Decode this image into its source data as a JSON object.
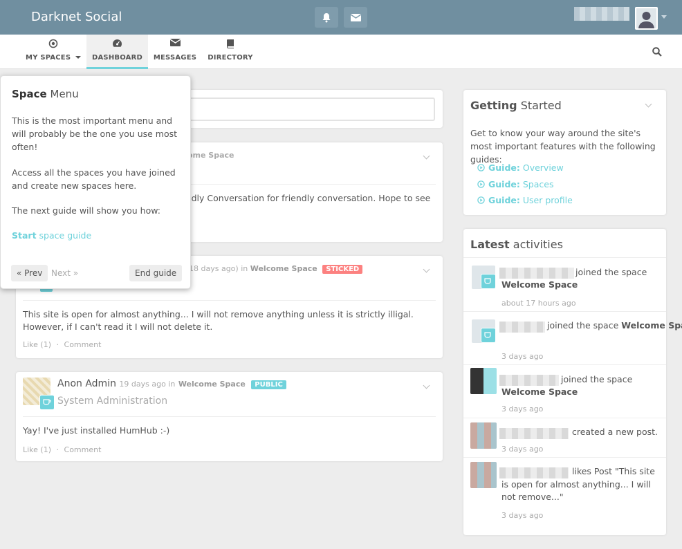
{
  "brand": "Darknet Social",
  "nav": {
    "my_spaces": "MY SPACES",
    "dashboard": "DASHBOARD",
    "messages": "MESSAGES",
    "directory": "DIRECTORY"
  },
  "guide": {
    "title_bold": "Space",
    "title_rest": "Menu",
    "p1": "This is the most important menu and will probably be the one you use most often!",
    "p2": "Access all the spaces you have joined and create new spaces here.",
    "p3": "The next guide will show you how:",
    "start_bold": "Start",
    "start_rest": "space guide",
    "prev": "« Prev",
    "next": "Next »",
    "end": "End guide"
  },
  "posts": [
    {
      "space_ref": "ome Space",
      "body": "endly Conversation for friendly conversation. Hope to see"
    },
    {
      "meta_time": "18 days ago) in",
      "space": "Welcome Space",
      "badge": "STICKED",
      "body": "This site is open for almost anything... I will not remove anything unless it is strictly illigal. However, if I can't read it I will not delete it.",
      "like": "Like (1)",
      "dot": "·",
      "comment": "Comment"
    },
    {
      "author": "Anon Admin",
      "meta_time": "19 days ago in",
      "space": "Welcome Space",
      "badge": "PUBLIC",
      "subtitle": "System Administration",
      "body": "Yay! I've just installed HumHub :-)",
      "like": "Like (1)",
      "dot": "·",
      "comment": "Comment"
    }
  ],
  "getting_started": {
    "title_bold": "Getting",
    "title_rest": "Started",
    "intro": "Get to know your way around the site's most important features with the following guides:",
    "links": [
      {
        "bold": "Guide:",
        "rest": "Overview"
      },
      {
        "bold": "Guide:",
        "rest": "Spaces"
      },
      {
        "bold": "Guide:",
        "rest": "User profile"
      }
    ]
  },
  "activities": {
    "title_bold": "Latest",
    "title_rest": "activities",
    "items": [
      {
        "text_a": "joined the space",
        "text_b": "Welcome Space",
        "time": "about 17 hours ago"
      },
      {
        "text_a": "joined the space",
        "text_b": "Welcome Space",
        "time": "3 days ago"
      },
      {
        "text_a": "joined the space",
        "text_b": "Welcome Space",
        "time": "3 days ago"
      },
      {
        "text_a": "created a new post.",
        "time": "3 days ago"
      },
      {
        "text_a": "likes Post \"This site is open for almost anything... I will not remove...\"",
        "time": "3 days ago"
      }
    ]
  },
  "colors": {
    "topbar": "#708fa0",
    "accent": "#6fd2db",
    "sticked": "#fc8180",
    "public": "#6fd2db"
  }
}
